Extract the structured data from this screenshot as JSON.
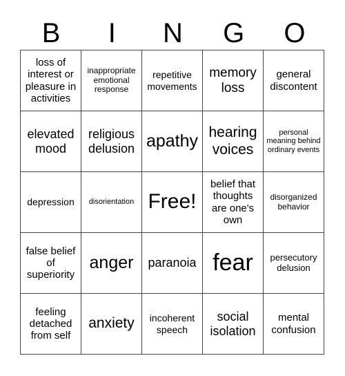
{
  "header": {
    "letters": [
      "B",
      "I",
      "N",
      "G",
      "O"
    ]
  },
  "board": {
    "rows": [
      [
        "loss of interest or pleasure in activities",
        "inappropriate emotional response",
        "repetitive movements",
        "memory loss",
        "general discontent"
      ],
      [
        "elevated mood",
        "religious delusion",
        "apathy",
        "hearing voices",
        "personal meaning behind ordinary events"
      ],
      [
        "depression",
        "disorientation",
        "Free!",
        "belief that thoughts are one's own",
        "disorganized behavior"
      ],
      [
        "false belief of superiority",
        "anger",
        "paranoia",
        "fear",
        "persecutory delusion"
      ],
      [
        "feeling detached from self",
        "anxiety",
        "incoherent speech",
        "social isolation",
        "mental confusion"
      ]
    ]
  }
}
